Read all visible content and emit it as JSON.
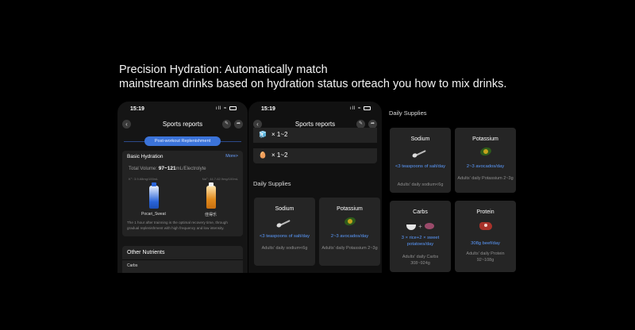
{
  "headline": {
    "line1": "Precision Hydration: Automatically match",
    "line2": "mainstream drinks based on hydration status orteach you how to mix drinks."
  },
  "phone1": {
    "status": {
      "time": "15:19"
    },
    "nav": {
      "title": "Sports reports",
      "back_icon": "‹",
      "edit_icon": "✎",
      "share_icon": "➦"
    },
    "tab": "Post-workout Replenishment",
    "hydration": {
      "title": "Basic Hydration",
      "more": "More>",
      "volume_label": "Total Volume:",
      "volume_value": "97~121",
      "volume_unit": "mL/Electrolyte",
      "k_left": "K⁺: 3.9-68mg/100mL",
      "k_right": "Na⁺: 44.7-62.9mg/100mL",
      "drink1": "Pocari_Sweat",
      "drink2": "佳得乐",
      "description": "The 1 hour after trainning is the optimal recovery time, through gradual replenishment with high frequency and low intensity."
    },
    "other": {
      "title": "Other Nutrients",
      "sub": "Carbs"
    }
  },
  "phone2": {
    "status": {
      "time": "15:19"
    },
    "nav": {
      "title": "Sports reports",
      "back_icon": "‹",
      "edit_icon": "✎",
      "share_icon": "➦"
    },
    "ratios": [
      {
        "icon": "🧊",
        "text": "× 1~2"
      },
      {
        "icon": "🥚",
        "text": "× 1~2"
      }
    ],
    "section": "Daily Supplies",
    "cards": [
      {
        "name": "Sodium",
        "value": "<3 teaspoons of salt/day",
        "daily": "Adults' daily sodium<6g"
      },
      {
        "name": "Potassium",
        "value": "2~3 avocados/day",
        "daily": "Adults' daily Potassium 2~3g"
      }
    ]
  },
  "right_panel": {
    "section": "Daily Supplies",
    "cards": [
      {
        "name": "Sodium",
        "value": "<3 teaspoons of salt/day",
        "daily": "Adults' daily sodium<6g"
      },
      {
        "name": "Potassium",
        "value": "2~3 avocados/day",
        "daily": "Adults' daily Potassium 2~3g"
      },
      {
        "name": "Carbs",
        "value": "3 × rice+2 × sweet potatoes/day",
        "daily": "Adults' daily Carbs 308~924g"
      },
      {
        "name": "Protein",
        "value": "308g beef/day",
        "daily": "Adults' daily Protein 92~108g"
      }
    ]
  },
  "colors": {
    "accent": "#3b73d9",
    "value_blue": "#5b9bff",
    "card": "#252525",
    "background": "#000000"
  }
}
